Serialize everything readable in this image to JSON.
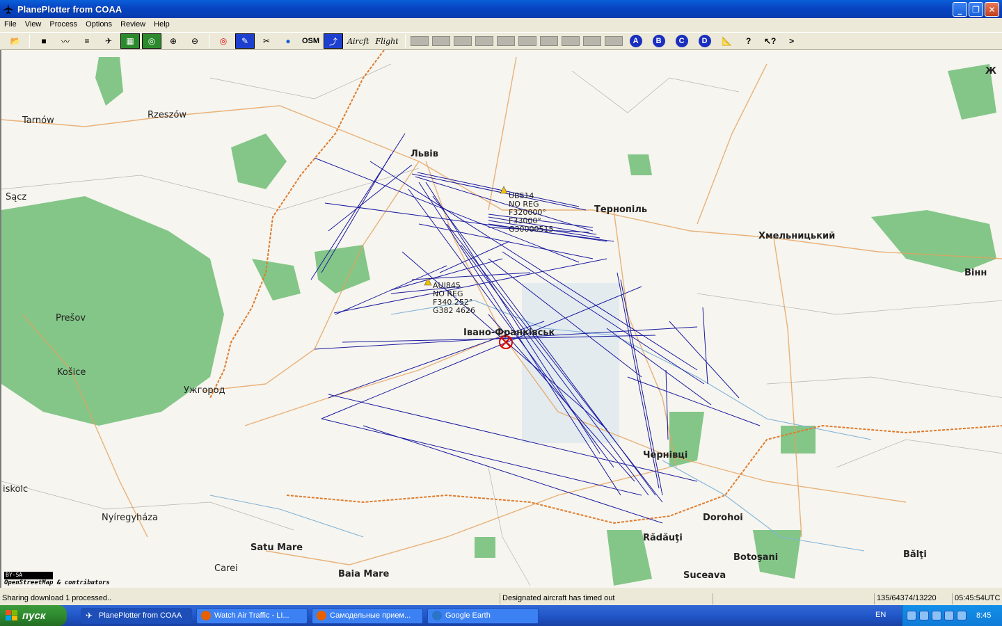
{
  "window": {
    "title": "PlanePlotter from COAA"
  },
  "menu": [
    "File",
    "View",
    "Process",
    "Options",
    "Review",
    "Help"
  ],
  "toolbar": {
    "osm_label": "OSM",
    "aircraft_label": "Aircft",
    "flight_label": "Flight",
    "circle_buttons": [
      "A",
      "B",
      "C",
      "D"
    ]
  },
  "map": {
    "places": [
      {
        "name": "Tarnów",
        "bold": false
      },
      {
        "name": "Rzeszów",
        "bold": false
      },
      {
        "name": "Sącz",
        "bold": false
      },
      {
        "name": "Львів",
        "bold": true
      },
      {
        "name": "Тернопіль",
        "bold": true
      },
      {
        "name": "Хмельницький",
        "bold": true
      },
      {
        "name": "Вінн",
        "bold": true
      },
      {
        "name": "Ж",
        "bold": true
      },
      {
        "name": "Prešov",
        "bold": false
      },
      {
        "name": "Košice",
        "bold": false
      },
      {
        "name": "Ужгород",
        "bold": false
      },
      {
        "name": "Івано-Франківськ",
        "bold": true
      },
      {
        "name": "Чернівці",
        "bold": true
      },
      {
        "name": "iskolc",
        "bold": false
      },
      {
        "name": "Nyíregyháza",
        "bold": false
      },
      {
        "name": "Satu Mare",
        "bold": true
      },
      {
        "name": "Carei",
        "bold": false
      },
      {
        "name": "Baia Mare",
        "bold": true
      },
      {
        "name": "Dorohoi",
        "bold": true
      },
      {
        "name": "Rădăuţi",
        "bold": true
      },
      {
        "name": "Botoşani",
        "bold": true
      },
      {
        "name": "Bălţi",
        "bold": true
      },
      {
        "name": "Suceava",
        "bold": true
      }
    ],
    "aircraft": [
      {
        "lines": [
          "UBS14",
          "NO REG",
          "F320000°",
          "F33000°",
          "G30000515"
        ]
      },
      {
        "lines": [
          "AUI845",
          "NO REG",
          "F340 252°",
          "G382 4626"
        ]
      }
    ],
    "license": "BY-SA",
    "attribution": "OpenStreetMap & contributors"
  },
  "status": {
    "left": "Sharing download 1 processed..",
    "middle": "Designated aircraft has timed out",
    "counts": "135/64374/13220",
    "utc": "05:45:54UTC"
  },
  "taskbar": {
    "start": "пуск",
    "tasks": [
      {
        "label": "PlanePlotter from COAA",
        "active": true
      },
      {
        "label": "Watch Air Traffic - LI...",
        "active": false
      },
      {
        "label": "Самодельные прием...",
        "active": false
      },
      {
        "label": "Google Earth",
        "active": false
      }
    ],
    "lang": "EN",
    "clock": "8:45"
  }
}
